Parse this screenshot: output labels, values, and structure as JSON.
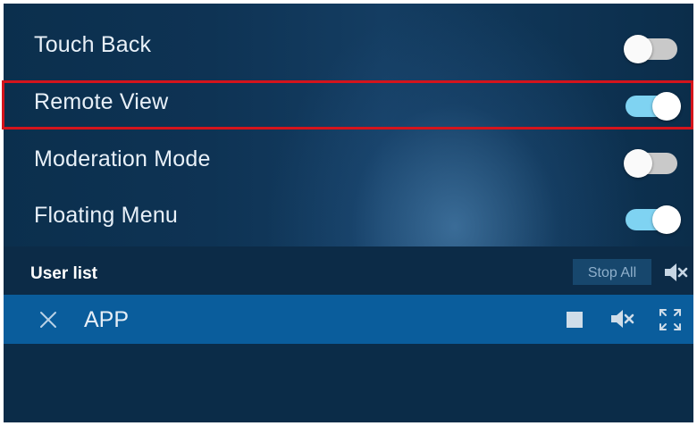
{
  "settings": {
    "items": [
      {
        "label": "Touch Back",
        "enabled": false
      },
      {
        "label": "Remote View",
        "enabled": true
      },
      {
        "label": "Moderation Mode",
        "enabled": false
      },
      {
        "label": "Floating Menu",
        "enabled": true
      }
    ]
  },
  "user_list": {
    "title": "User list",
    "stop_all_label": "Stop All",
    "users": [
      {
        "name": "APP"
      }
    ]
  },
  "colors": {
    "toggle_on": "#7fd3f2",
    "toggle_off": "#c9c9c9",
    "highlight": "#d4141c",
    "user_row": "#0a5d9c"
  },
  "icons": {
    "mute_all": "speaker-muted-icon",
    "remove_user": "close-icon",
    "stop_user": "stop-icon",
    "mute_user": "speaker-muted-icon",
    "fullscreen_user": "expand-icon"
  }
}
